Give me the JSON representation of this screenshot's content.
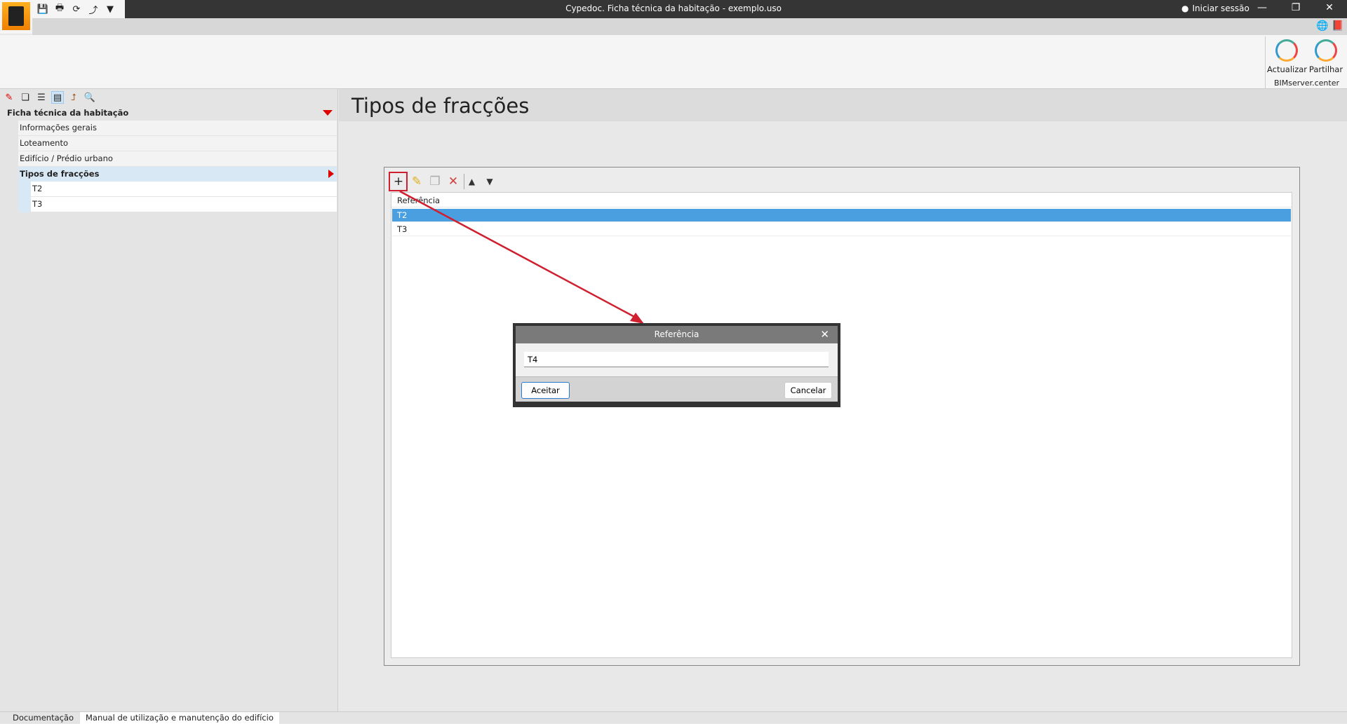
{
  "window": {
    "title": "Cypedoc. Ficha técnica da habitação - exemplo.uso",
    "login": "Iniciar sessão",
    "minimize": "—",
    "restore": "❐",
    "close": "✕"
  },
  "ribbon": {
    "buttons": [
      {
        "label": "Actualizar"
      },
      {
        "label": "Partilhar"
      }
    ],
    "group": "BIMserver.center"
  },
  "sidebar": {
    "header": "Ficha técnica da habitação",
    "items": [
      {
        "label": "Informações gerais"
      },
      {
        "label": "Loteamento"
      },
      {
        "label": "Edifício / Prédio urbano"
      },
      {
        "label": "Tipos de fracções",
        "children": [
          "T2",
          "T3"
        ]
      }
    ]
  },
  "main": {
    "title": "Tipos de fracções",
    "list": {
      "header": "Referência",
      "rows": [
        "T2",
        "T3"
      ]
    }
  },
  "dialog": {
    "title": "Referência",
    "value": "T4",
    "accept": "Aceitar",
    "cancel": "Cancelar"
  },
  "bottom_tabs": [
    "Documentação",
    "Manual de utilização e manutenção do edifício"
  ],
  "colors": {
    "selection": "#4a9fe0",
    "annotation": "#d02030",
    "logo": "#f39200"
  }
}
